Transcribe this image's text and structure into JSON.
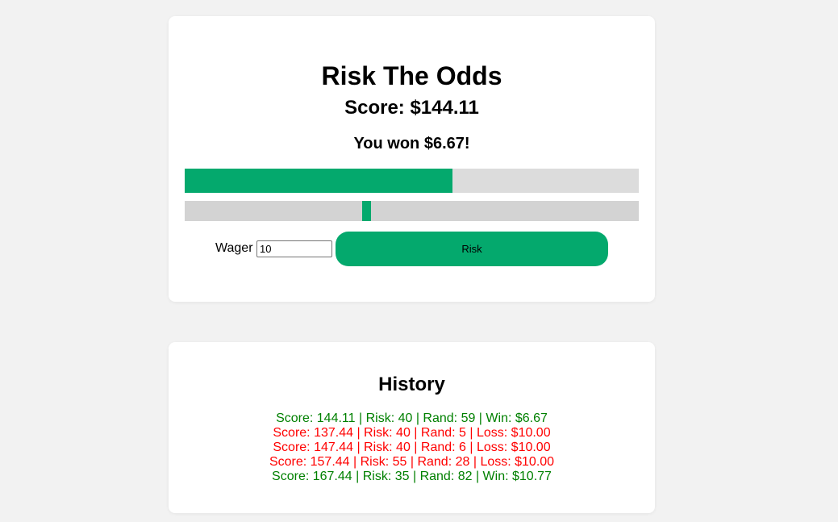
{
  "game": {
    "title": "Risk The Odds",
    "score_text": "Score: $144.11",
    "result_text": "You won $6.67!",
    "odds_fill_percent": 59,
    "risk_value": 40,
    "wager_label": "Wager",
    "wager_value": "10",
    "risk_button_label": "Risk"
  },
  "history": {
    "title": "History",
    "entries": [
      {
        "text": "Score: 144.11 | Risk: 40 | Rand: 59 | Win: $6.67",
        "outcome": "win"
      },
      {
        "text": "Score: 137.44 | Risk: 40 | Rand: 5 | Loss: $10.00",
        "outcome": "loss"
      },
      {
        "text": "Score: 147.44 | Risk: 40 | Rand: 6 | Loss: $10.00",
        "outcome": "loss"
      },
      {
        "text": "Score: 157.44 | Risk: 55 | Rand: 28 | Loss: $10.00",
        "outcome": "loss"
      },
      {
        "text": "Score: 167.44 | Risk: 35 | Rand: 82 | Win: $10.77",
        "outcome": "win"
      }
    ]
  },
  "colors": {
    "accent": "#04a96d",
    "win": "#008000",
    "loss": "#ff0000",
    "track": "#d3d3d3",
    "background": "#f2f2f2"
  }
}
